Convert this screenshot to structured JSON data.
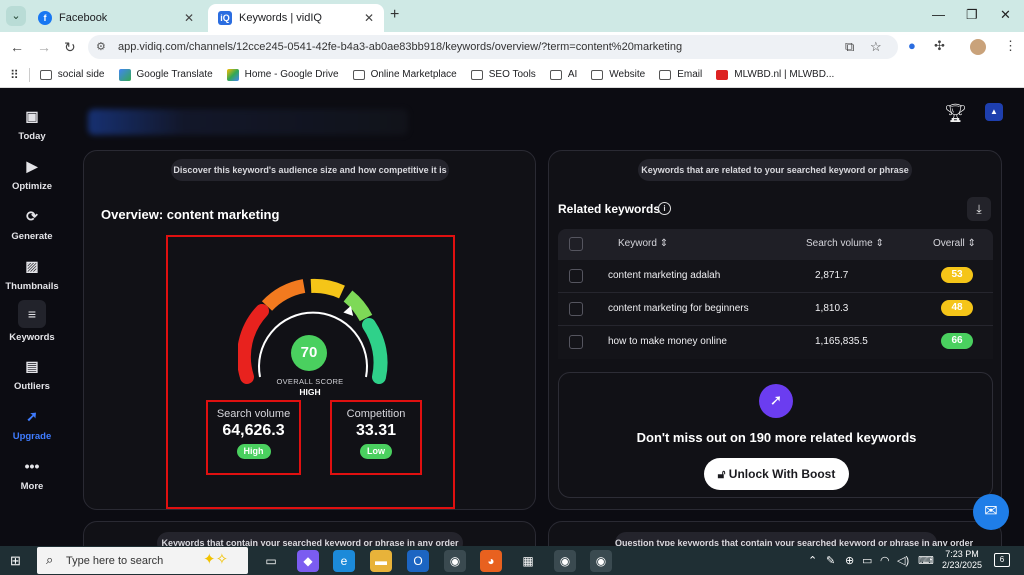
{
  "browser": {
    "tabs": [
      {
        "label": "Facebook",
        "icon": "facebook-icon",
        "color": "#1877f2",
        "glyph": "f"
      },
      {
        "label": "Keywords | vidIQ",
        "icon": "vidiq-icon",
        "color": "#2b6de0",
        "glyph": "iQ"
      }
    ],
    "url": "app.vidiq.com/channels/12cce245-0541-42fe-b4a3-ab0ae83bb918/keywords/overview/?term=content%20marketing",
    "bookmarks": [
      "social side",
      "Google Translate",
      "Home - Google Drive",
      "Online Marketplace",
      "SEO Tools",
      "AI",
      "Website",
      "Email",
      "MLWBD.nl | MLWBD..."
    ]
  },
  "sidebar": {
    "items": [
      {
        "label": "Today",
        "icon": "calendar-check-icon",
        "glyph": "▣"
      },
      {
        "label": "Optimize",
        "icon": "video-optimize-icon",
        "glyph": "▶"
      },
      {
        "label": "Generate",
        "icon": "generate-icon",
        "glyph": "⟳"
      },
      {
        "label": "Thumbnails",
        "icon": "image-icon",
        "glyph": "▨"
      },
      {
        "label": "Keywords",
        "icon": "keywords-icon",
        "glyph": "≡"
      },
      {
        "label": "Outliers",
        "icon": "outliers-icon",
        "glyph": "▤"
      },
      {
        "label": "Upgrade",
        "icon": "rocket-icon",
        "glyph": "➚"
      },
      {
        "label": "More",
        "icon": "more-dots-icon",
        "glyph": "•••"
      }
    ]
  },
  "overview": {
    "hint": "Discover this keyword's audience size and how competitive it is",
    "title": "Overview: content marketing",
    "score": "70",
    "score_fraction": 0.7,
    "score_label": "OVERALL SCORE",
    "score_level": "HIGH",
    "search_volume": {
      "label": "Search volume",
      "value": "64,626.3",
      "badge": "High"
    },
    "competition": {
      "label": "Competition",
      "value": "33.31",
      "badge": "Low"
    }
  },
  "related": {
    "hint": "Keywords that are related to your searched keyword or phrase",
    "title": "Related keywords",
    "columns": [
      "Keyword",
      "Search volume",
      "Overall"
    ],
    "rows": [
      {
        "keyword": "content marketing adalah",
        "volume": "2,871.7",
        "overall": "53",
        "color": "#f5c518"
      },
      {
        "keyword": "content marketing for beginners",
        "volume": "1,810.3",
        "overall": "48",
        "color": "#f5c518"
      },
      {
        "keyword": "how to make money online",
        "volume": "1,165,835.5",
        "overall": "66",
        "color": "#4ad05f"
      }
    ],
    "boost_text": "Don't miss out on 190 more related keywords",
    "unlock_label": "Unlock With Boost"
  },
  "bottom_hints": {
    "left": "Keywords that contain your searched keyword or phrase in any order",
    "right": "Question type keywords that contain your searched keyword or phrase in any order"
  },
  "taskbar": {
    "search_placeholder": "Type here to search",
    "time": "7:23 PM",
    "date": "2/23/2025",
    "notification_count": "6"
  }
}
